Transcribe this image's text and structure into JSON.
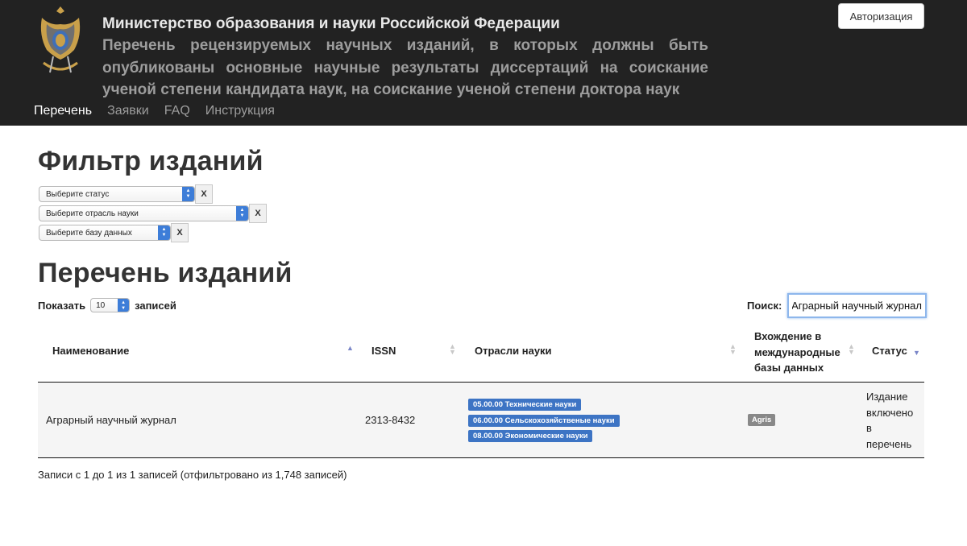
{
  "header": {
    "ministry": "Министерство образования и науки Российской Федерации",
    "subtitle": "Перечень рецензируемых научных изданий, в которых должны быть опубликованы основные научные результаты диссертаций на соискание ученой степени кандидата наук, на соискание ученой степени доктора наук",
    "auth_label": "Авторизация"
  },
  "nav": [
    {
      "label": "Перечень"
    },
    {
      "label": "Заявки"
    },
    {
      "label": "FAQ"
    },
    {
      "label": "Инструкция"
    }
  ],
  "filter": {
    "title": "Фильтр изданий",
    "status_placeholder": "Выберите статус",
    "science_placeholder": "Выберите отрасль науки",
    "database_placeholder": "Выберите базу данных",
    "clear_label": "X"
  },
  "list": {
    "title": "Перечень изданий",
    "show_label": "Показать",
    "show_value": "10",
    "records_label": "записей",
    "search_label": "Поиск:",
    "search_value": "Аграрный научный журнал",
    "columns": {
      "name": "Наименование",
      "issn": "ISSN",
      "science": "Отрасли науки",
      "databases": "Вхождение в международные базы данных",
      "status": "Статус"
    },
    "rows": [
      {
        "name": "Аграрный научный журнал",
        "issn": "2313-8432",
        "sciences": [
          "05.00.00 Технические науки",
          "06.00.00 Сельскохозяйственые науки",
          "08.00.00 Экономические науки"
        ],
        "database": "Agris",
        "status": "Издание включено в перечень"
      }
    ],
    "info": "Записи с 1 до 1 из 1 записей (отфильтровано из 1,748 записей)"
  },
  "colors": {
    "header_bg": "#222222",
    "label_blue": "#3d74c4",
    "label_grey": "#888888"
  }
}
